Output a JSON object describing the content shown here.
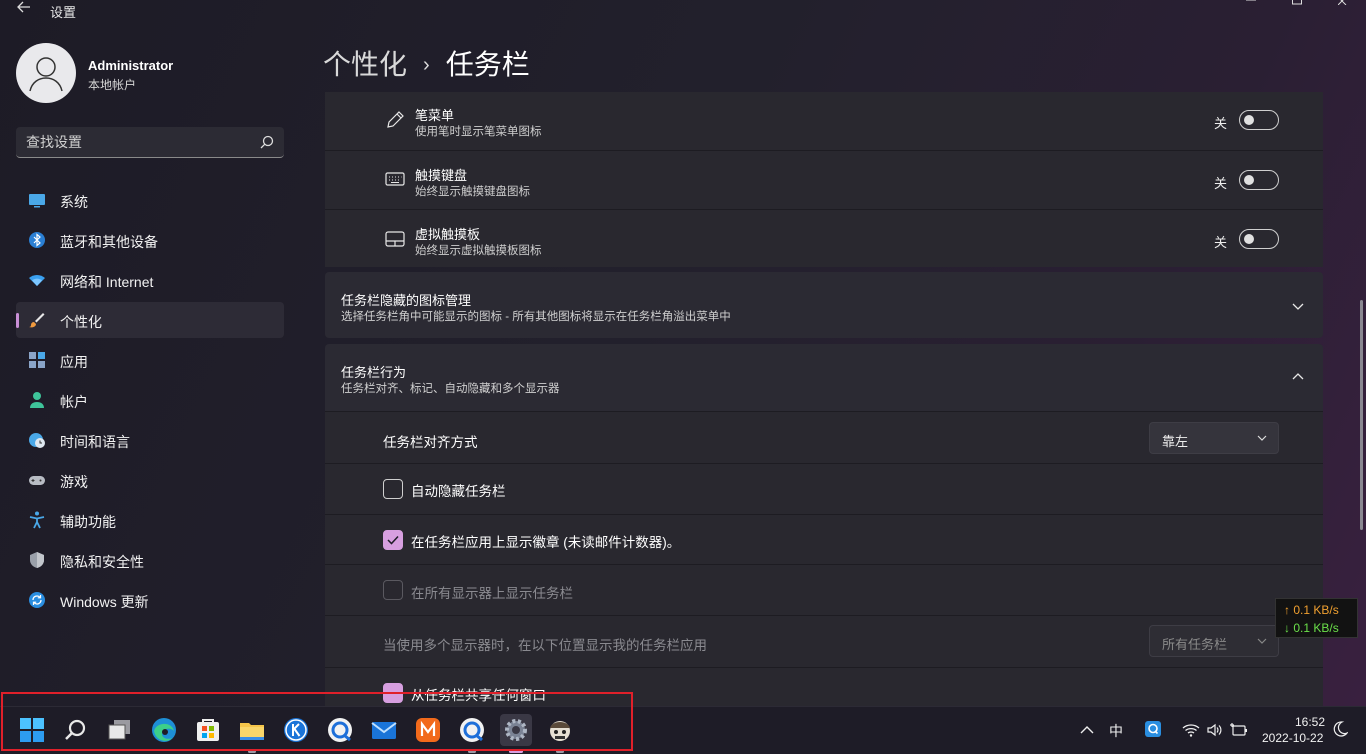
{
  "window": {
    "title": "设置",
    "back_icon": "arrow-left-icon",
    "minimize_icon": "minimize-icon",
    "maximize_icon": "maximize-icon",
    "close_icon": "close-icon"
  },
  "user": {
    "name": "Administrator",
    "account_type": "本地帐户"
  },
  "search": {
    "placeholder": "查找设置"
  },
  "sidebar": {
    "items": [
      {
        "label": "系统",
        "icon": "monitor-icon",
        "active": false
      },
      {
        "label": "蓝牙和其他设备",
        "icon": "bluetooth-icon",
        "active": false
      },
      {
        "label": "网络和 Internet",
        "icon": "wifi-icon",
        "active": false
      },
      {
        "label": "个性化",
        "icon": "brush-icon",
        "active": true
      },
      {
        "label": "应用",
        "icon": "apps-icon",
        "active": false
      },
      {
        "label": "帐户",
        "icon": "person-icon",
        "active": false
      },
      {
        "label": "时间和语言",
        "icon": "clock-globe-icon",
        "active": false
      },
      {
        "label": "游戏",
        "icon": "gamepad-icon",
        "active": false
      },
      {
        "label": "辅助功能",
        "icon": "accessibility-icon",
        "active": false
      },
      {
        "label": "隐私和安全性",
        "icon": "shield-icon",
        "active": false
      },
      {
        "label": "Windows 更新",
        "icon": "update-icon",
        "active": false
      }
    ]
  },
  "header": {
    "parent": "个性化",
    "separator": "›",
    "current": "任务栏"
  },
  "corner_icons": [
    {
      "title": "笔菜单",
      "subtitle": "使用笔时显示笔菜单图标",
      "state": "关",
      "on": false,
      "icon": "pen-icon"
    },
    {
      "title": "触摸键盘",
      "subtitle": "始终显示触摸键盘图标",
      "state": "关",
      "on": false,
      "icon": "keyboard-icon"
    },
    {
      "title": "虚拟触摸板",
      "subtitle": "始终显示虚拟触摸板图标",
      "state": "关",
      "on": false,
      "icon": "touchpad-icon"
    }
  ],
  "overflow_section": {
    "title": "任务栏隐藏的图标管理",
    "subtitle": "选择任务栏角中可能显示的图标 - 所有其他图标将显示在任务栏角溢出菜单中",
    "expanded": false
  },
  "behavior_section": {
    "title": "任务栏行为",
    "subtitle": "任务栏对齐、标记、自动隐藏和多个显示器",
    "expanded": true,
    "alignment_label": "任务栏对齐方式",
    "alignment_value": "靠左",
    "auto_hide_label": "自动隐藏任务栏",
    "auto_hide_checked": false,
    "badges_label": "在任务栏应用上显示徽章 (未读邮件计数器)。",
    "badges_checked": true,
    "all_displays_label": "在所有显示器上显示任务栏",
    "all_displays_checked": false,
    "multi_display_label": "当使用多个显示器时，在以下位置显示我的任务栏应用",
    "multi_display_value": "所有任务栏",
    "share_window_label": "从任务栏共享任何窗口",
    "share_window_checked": true
  },
  "network_widget": {
    "upload": "↑ 0.1 KB/s",
    "download": "↓ 0.1 KB/s",
    "upload_color": "#f0a030",
    "download_color": "#6be04a"
  },
  "taskbar": {
    "apps": [
      {
        "name": "start-icon",
        "running": false,
        "active": false
      },
      {
        "name": "search-icon",
        "running": false,
        "active": false
      },
      {
        "name": "task-view-icon",
        "running": false,
        "active": false
      },
      {
        "name": "edge-icon",
        "running": false,
        "active": false
      },
      {
        "name": "store-icon",
        "running": false,
        "active": false
      },
      {
        "name": "file-explorer-icon",
        "running": true,
        "active": false
      },
      {
        "name": "k-app-icon",
        "running": false,
        "active": false
      },
      {
        "name": "browser-app-icon",
        "running": false,
        "active": false
      },
      {
        "name": "mail-icon",
        "running": false,
        "active": false
      },
      {
        "name": "orange-app-icon",
        "running": false,
        "active": false
      },
      {
        "name": "browser-app-2-icon",
        "running": true,
        "active": false
      },
      {
        "name": "settings-icon",
        "running": true,
        "active": true
      },
      {
        "name": "character-app-icon",
        "running": true,
        "active": false
      }
    ],
    "tray": {
      "chevron": "^",
      "ime": "中",
      "qq_icon": "qq-icon",
      "wifi_icon": "wifi-icon",
      "volume_icon": "volume-icon",
      "battery_icon": "battery-icon",
      "moon_icon": "moon-icon"
    },
    "time": "16:52",
    "date": "2022-10-22"
  },
  "colors": {
    "accent": "#d79fe0",
    "highlight_box": "#e0202a"
  }
}
